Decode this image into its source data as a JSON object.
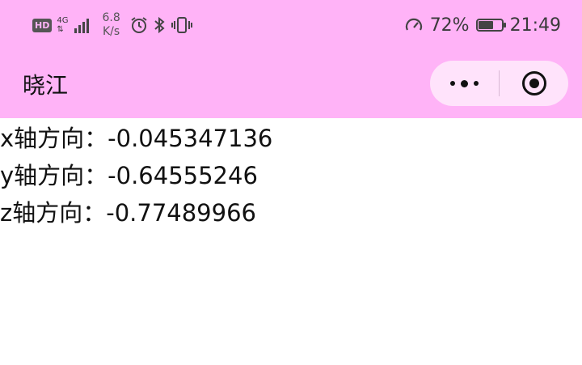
{
  "status_bar": {
    "hd_label": "HD",
    "network_label": "4G",
    "speed_value": "6.8",
    "speed_unit": "K/s",
    "battery_percent": "72%",
    "battery_level": 0.72,
    "time": "21:49",
    "icons": [
      "alarm-icon",
      "bluetooth-icon",
      "vibrate-icon",
      "power-saver-icon",
      "battery-icon"
    ]
  },
  "nav": {
    "title": "晓江",
    "more_icon": "more-dots-icon",
    "close_icon": "target-close-icon"
  },
  "colors": {
    "bar_background": "#ffb3f7",
    "capsule_background": "#ffe3fb",
    "text": "#111111"
  },
  "sensor": {
    "x_label": "x轴方向：",
    "x_value": "-0.045347136",
    "y_label": "y轴方向：",
    "y_value": "-0.64555246",
    "z_label": "z轴方向：",
    "z_value": "-0.77489966"
  }
}
